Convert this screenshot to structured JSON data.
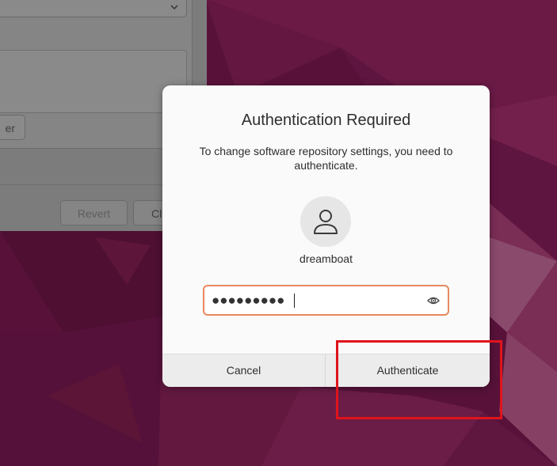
{
  "background_window": {
    "partial_button_label": "er",
    "revert_label": "Revert",
    "close_partial_label": "Cl"
  },
  "dialog": {
    "title": "Authentication Required",
    "description": "To change software repository settings, you need to authenticate.",
    "username": "dreamboat",
    "password_masked": "●●●●●●●●●",
    "cancel_label": "Cancel",
    "authenticate_label": "Authenticate"
  },
  "icons": {
    "avatar": "user-icon",
    "reveal": "eye-icon",
    "combo": "chevron-down-icon"
  },
  "colors": {
    "wallpaper": "#5a1238",
    "field_focus": "#e9885f",
    "highlight": "#e0141b"
  }
}
